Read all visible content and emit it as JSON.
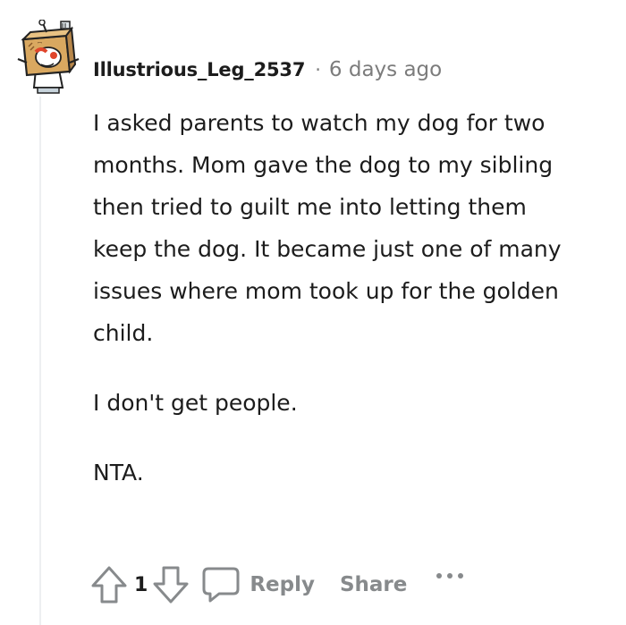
{
  "comment": {
    "author": "Illustrious_Leg_2537",
    "separator": "·",
    "timestamp": "6 days ago",
    "paragraphs": [
      "I asked parents to watch my dog for two months. Mom gave the dog to my sibling then tried to guilt me into letting them keep the dog. It became just one of many issues where mom took up for the golden child.",
      "I don't get people.",
      "NTA."
    ]
  },
  "actions": {
    "upvote_icon": "upvote-arrow-icon",
    "vote_count": "1",
    "downvote_icon": "downvote-arrow-icon",
    "reply_icon": "comment-bubble-icon",
    "reply_label": "Reply",
    "share_label": "Share",
    "more_icon": "more-dots-icon"
  },
  "colors": {
    "text": "#1c1c1c",
    "muted": "#7c7c7c",
    "action_gray": "#878a8c",
    "thread_line": "#edeff1"
  }
}
